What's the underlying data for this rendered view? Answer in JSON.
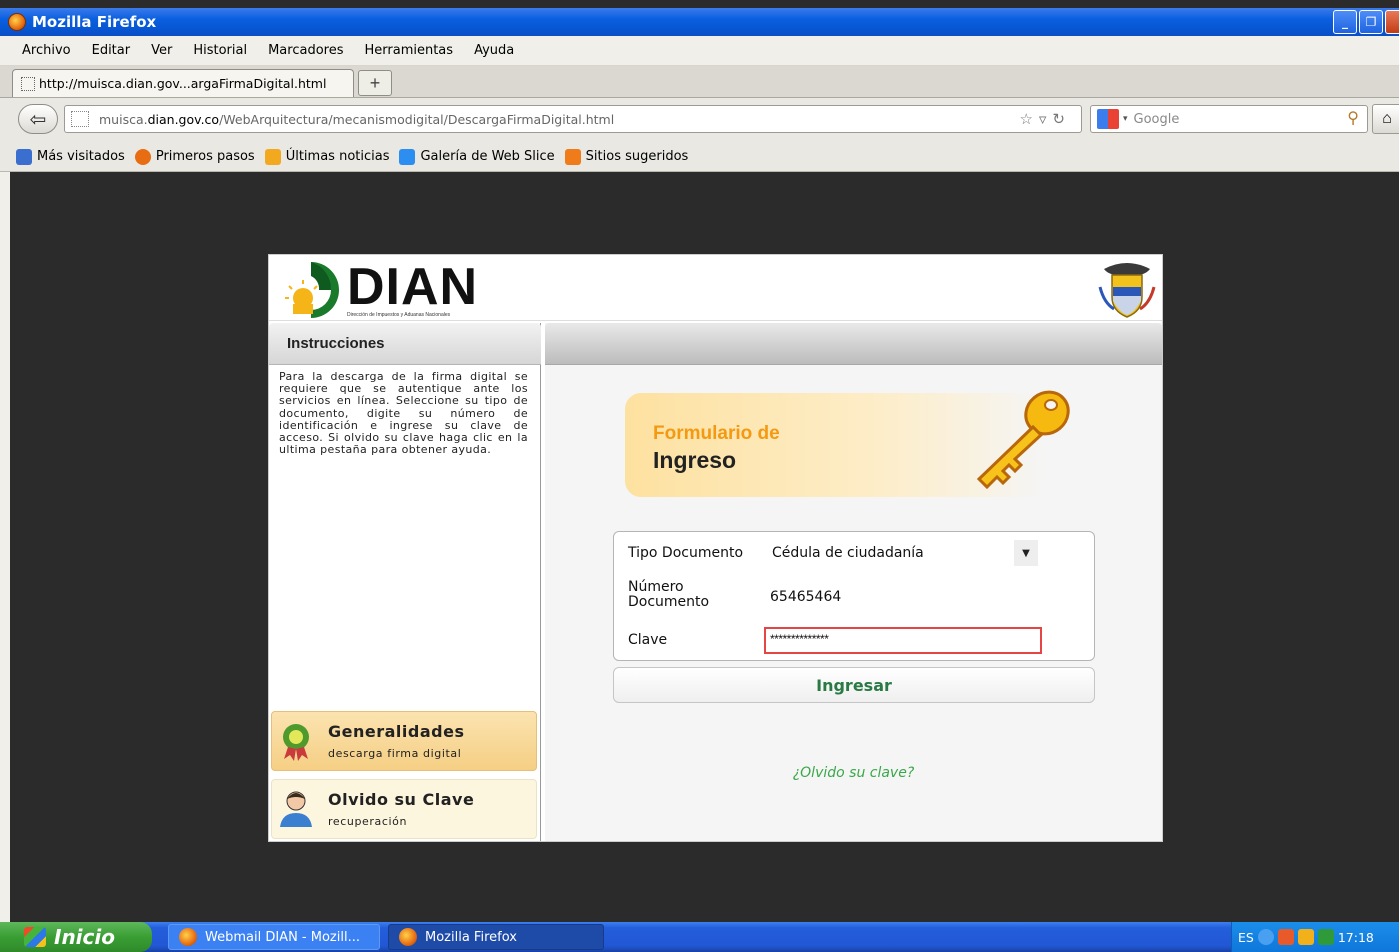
{
  "window": {
    "title": "Mozilla Firefox"
  },
  "menu": [
    "Archivo",
    "Editar",
    "Ver",
    "Historial",
    "Marcadores",
    "Herramientas",
    "Ayuda"
  ],
  "tab": {
    "title": "http://muisca.dian.gov...argaFirmaDigital.html",
    "new_tab_label": "+"
  },
  "url": {
    "prefix": "muisca.",
    "domain": "dian.gov.co",
    "path": "/WebArquitectura/mecanismodigital/DescargaFirmaDigital.html"
  },
  "search": {
    "placeholder": "Google"
  },
  "bookmarks": [
    {
      "label": "Más visitados",
      "icon": "most-visited-icon",
      "color": "#3a6fd0"
    },
    {
      "label": "Primeros pasos",
      "icon": "firefox-icon",
      "color": "#e86d12"
    },
    {
      "label": "Últimas noticias",
      "icon": "rss-icon",
      "color": "#f2a81f"
    },
    {
      "label": "Galería de Web Slice",
      "icon": "web-slice-icon",
      "color": "#2c8ef0"
    },
    {
      "label": "Sitios sugeridos",
      "icon": "suggested-sites-icon",
      "color": "#f07b1a"
    }
  ],
  "page": {
    "logo_text": "DIAN",
    "logo_subtitle": "Dirección de Impuestos y Aduanas Nacionales",
    "instructions_title": "Instrucciones",
    "instructions_body": "Para la descarga de la firma digital se requiere que se autentique ante los servicios en línea. Seleccione su tipo de documento, digite su número de identificación e ingrese su clave de acceso. Si olvido su clave haga clic en la ultima pestaña para obtener ayuda.",
    "side_items": [
      {
        "title": "Generalidades",
        "subtitle": "descarga firma digital"
      },
      {
        "title": "Olvido su Clave",
        "subtitle": "recuperación"
      }
    ],
    "banner_line1": "Formulario de",
    "banner_line2": "Ingreso",
    "form": {
      "tipo_label": "Tipo Documento",
      "tipo_value": "Cédula de ciudadanía",
      "numero_label": "Número Documento",
      "numero_value": "65465464",
      "clave_label": "Clave",
      "clave_value": "**************"
    },
    "submit_label": "Ingresar",
    "forgot_link": "¿Olvido su clave?"
  },
  "taskbar": {
    "start_label": "Inicio",
    "items": [
      "Webmail DIAN - Mozill...",
      "Mozilla Firefox"
    ],
    "language": "ES",
    "clock": "17:18"
  }
}
